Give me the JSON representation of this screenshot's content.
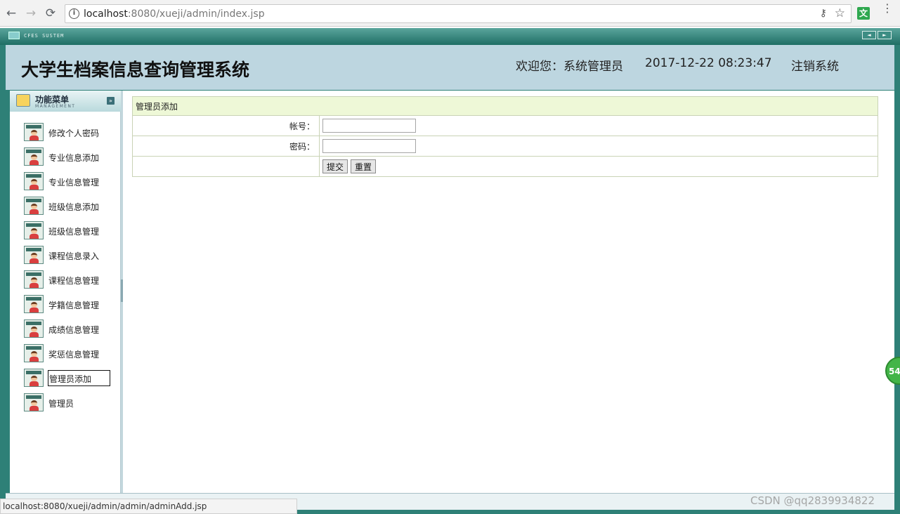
{
  "browser": {
    "nav_back": "←",
    "nav_forward": "→",
    "nav_reload": "⟳",
    "info_icon": "i",
    "url_host": "localhost",
    "url_rest": ":8080/xueji/admin/index.jsp",
    "key_icon": "⚷",
    "star_icon": "☆",
    "ext_label": "文",
    "menu_icon": "⋮"
  },
  "app": {
    "strip_logo": "CFES SUSTEM",
    "strip_prev": "◄",
    "strip_next": "►",
    "title": "大学生档案信息查询管理系统",
    "welcome": "欢迎您：系统管理员",
    "datetime": "2017-12-22 08:23:47",
    "logout": "注销系统"
  },
  "sidebar": {
    "title": "功能菜单",
    "subtitle": "MANAGEMENT",
    "toggle": "»",
    "items": [
      {
        "label": "修改个人密码"
      },
      {
        "label": "专业信息添加"
      },
      {
        "label": "专业信息管理"
      },
      {
        "label": "班级信息添加"
      },
      {
        "label": "班级信息管理"
      },
      {
        "label": "课程信息录入"
      },
      {
        "label": "课程信息管理"
      },
      {
        "label": "学籍信息管理"
      },
      {
        "label": "成绩信息管理"
      },
      {
        "label": "奖惩信息管理"
      },
      {
        "label": "管理员添加"
      },
      {
        "label": "管理员"
      }
    ]
  },
  "form": {
    "caption": "管理员添加",
    "account_label": "帐号：",
    "account_value": "",
    "password_label": "密码：",
    "password_value": "",
    "submit": "提交",
    "reset": "重置"
  },
  "status": {
    "hover_url": "localhost:8080/xueji/admin/admin/adminAdd.jsp",
    "watermark": "CSDN @qq2839934822",
    "badge": "54"
  },
  "colors": {
    "frame": "#2e8077",
    "header": "#bdd6e0",
    "caption_bg": "#eef8d7"
  }
}
